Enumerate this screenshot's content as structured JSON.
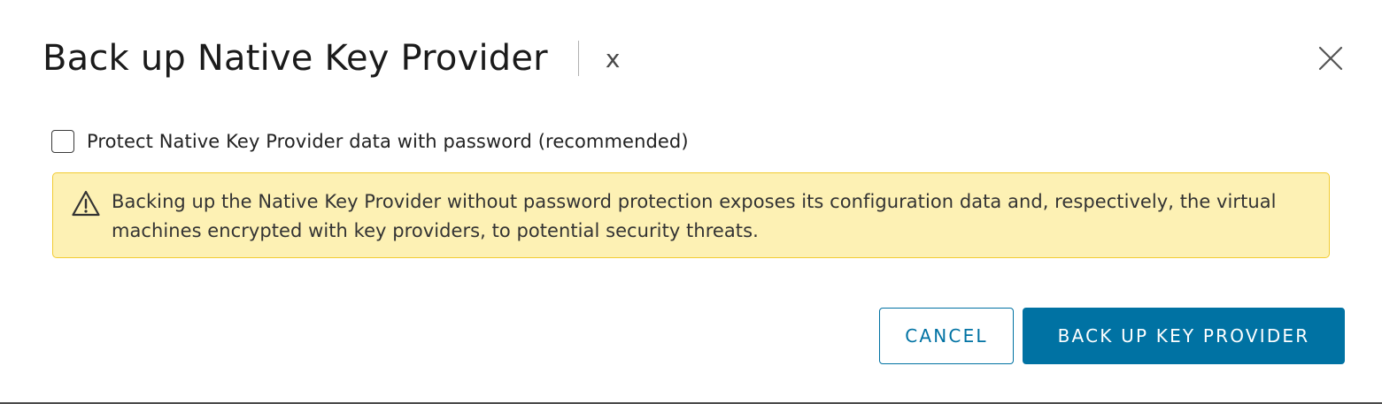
{
  "dialog": {
    "title": "Back up Native Key Provider",
    "title_suffix": "x",
    "close_icon": "close-icon"
  },
  "checkbox": {
    "label": "Protect Native Key Provider data with password (recommended)",
    "checked": false
  },
  "alert": {
    "type": "warning",
    "icon": "warning-triangle-icon",
    "message": "Backing up the Native Key Provider without password protection exposes its configuration data and, respectively, the virtual machines encrypted with key providers, to potential security threats.",
    "background_color": "#fdf1b4",
    "border_color": "#f2cb32"
  },
  "buttons": {
    "cancel_label": "CANCEL",
    "primary_label": "BACK UP KEY PROVIDER",
    "accent_color": "#0072a3"
  }
}
